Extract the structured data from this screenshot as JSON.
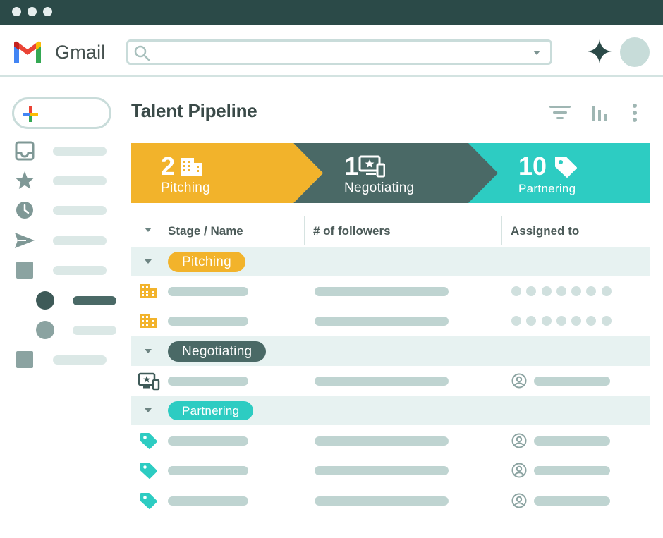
{
  "app": {
    "name": "Gmail"
  },
  "search": {
    "value": "",
    "placeholder": ""
  },
  "page": {
    "title": "Talent Pipeline"
  },
  "stages": [
    {
      "count": "2",
      "label": "Pitching",
      "icon": "building-icon",
      "color": "#f2b32b"
    },
    {
      "count": "1",
      "label": "Negotiating",
      "icon": "monitor-star-icon",
      "color": "#4a6966"
    },
    {
      "count": "10",
      "label": "Partnering",
      "icon": "tag-icon",
      "color": "#2dccc2"
    }
  ],
  "table": {
    "columns": [
      "Stage / Name",
      "# of followers",
      "Assigned to"
    ],
    "groups": [
      {
        "label": "Pitching",
        "color": "#f2b32b",
        "rows": 2,
        "row_icon": "building-icon",
        "assignee": "unassigned-dots"
      },
      {
        "label": "Negotiating",
        "color": "#4a6966",
        "rows": 1,
        "row_icon": "monitor-star-icon",
        "assignee": "person-icon"
      },
      {
        "label": "Partnering",
        "color": "#2dccc2",
        "rows": 3,
        "row_icon": "tag-icon",
        "assignee": "person-icon"
      }
    ]
  },
  "sidebar": {
    "icons": [
      "inbox-icon",
      "star-icon",
      "clock-icon",
      "send-icon",
      "label-square-icon",
      "dot-label-icon",
      "dot-label-icon",
      "label-square-icon"
    ]
  },
  "colors": {
    "titlebar": "#2b4a48",
    "accent_yellow": "#f2b32b",
    "accent_dark": "#4a6966",
    "accent_teal": "#2dccc2",
    "placeholder": "#bfd4d1"
  }
}
